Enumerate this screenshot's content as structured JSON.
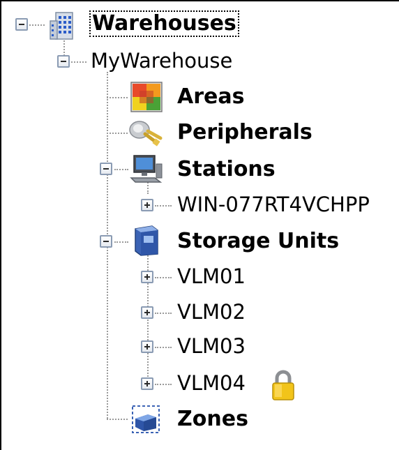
{
  "tree": {
    "root": {
      "label": "Warehouses",
      "icon": "building-icon",
      "expanded": true,
      "focused": true
    },
    "warehouse": {
      "label": "MyWarehouse",
      "expanded": true
    },
    "areas": {
      "label": "Areas",
      "icon": "areas-icon"
    },
    "peripherals": {
      "label": "Peripherals",
      "icon": "plug-icon"
    },
    "stations": {
      "label": "Stations",
      "icon": "computer-icon",
      "expanded": true,
      "children": [
        {
          "label": "WIN-077RT4VCHPP",
          "expanded": false
        }
      ]
    },
    "storage_units": {
      "label": "Storage Units",
      "icon": "storage-unit-icon",
      "expanded": true,
      "children": [
        {
          "label": "VLM01",
          "expanded": false
        },
        {
          "label": "VLM02",
          "expanded": false
        },
        {
          "label": "VLM03",
          "expanded": false
        },
        {
          "label": "VLM04",
          "expanded": false,
          "locked": true
        }
      ]
    },
    "zones": {
      "label": "Zones",
      "icon": "zones-icon"
    }
  }
}
